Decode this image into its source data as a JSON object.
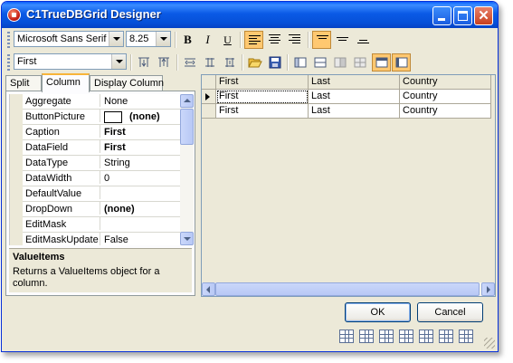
{
  "window": {
    "title": "C1TrueDBGrid Designer"
  },
  "toolbar1": {
    "font_name": "Microsoft Sans Serif",
    "font_size": "8.25",
    "bold_label": "B",
    "italic_label": "I",
    "underline_label": "U"
  },
  "toolbar2": {
    "column_select": "First"
  },
  "tabs": [
    "Split",
    "Column",
    "Display Column"
  ],
  "properties": [
    {
      "name": "Aggregate",
      "value": "None"
    },
    {
      "name": "ButtonPicture",
      "value": "(none)"
    },
    {
      "name": "Caption",
      "value": "First"
    },
    {
      "name": "DataField",
      "value": "First"
    },
    {
      "name": "DataType",
      "value": "String"
    },
    {
      "name": "DataWidth",
      "value": "0"
    },
    {
      "name": "DefaultValue",
      "value": ""
    },
    {
      "name": "DropDown",
      "value": "(none)"
    },
    {
      "name": "EditMask",
      "value": ""
    },
    {
      "name": "EditMaskUpdate",
      "value": "False"
    }
  ],
  "help": {
    "title": "ValueItems",
    "description": "Returns a ValueItems object for a column."
  },
  "grid": {
    "columns": [
      "First",
      "Last",
      "Country"
    ],
    "rows": [
      [
        "First",
        "Last",
        "Country"
      ],
      [
        "First",
        "Last",
        "Country"
      ]
    ]
  },
  "buttons": {
    "ok": "OK",
    "cancel": "Cancel"
  }
}
